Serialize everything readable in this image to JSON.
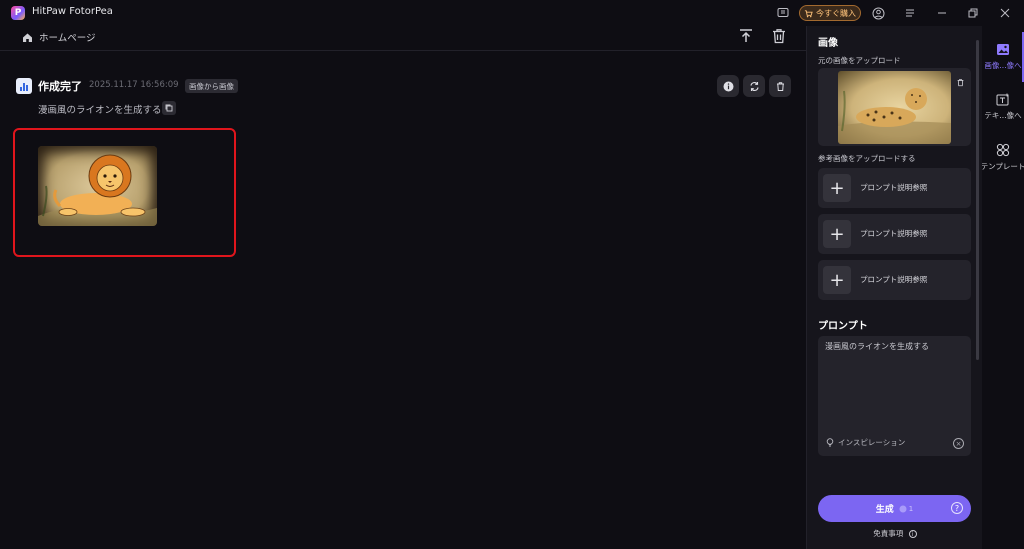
{
  "app": {
    "title": "HitPaw FotorPea",
    "logo_letter": "P"
  },
  "titlebar": {
    "buy_label": "今すぐ購入"
  },
  "nav": {
    "home_label": "ホームページ"
  },
  "result": {
    "title": "作成完了",
    "date": "2025.11.17  16:56:09",
    "tag": "画像から画像",
    "prompt": "漫画風のライオンを生成する"
  },
  "panel": {
    "section_title": "画像",
    "upload_original_label": "元の画像をアップロード",
    "upload_reference_label": "参考画像をアップロードする",
    "reference_items": [
      {
        "label": "プロンプト説明参照"
      },
      {
        "label": "プロンプト説明参照"
      },
      {
        "label": "プロンプト説明参照"
      }
    ],
    "prompt_title": "プロンプト",
    "prompt_text": "漫画風のライオンを生成する",
    "inspiration_label": "インスピレーション",
    "generate_label": "生成",
    "generate_cost": "1",
    "disclaimer": "免責事項"
  },
  "side_tabs": [
    {
      "label": "画像...像へ",
      "active": true
    },
    {
      "label": "テキ...像へ",
      "active": false
    },
    {
      "label": "テンプレート",
      "active": false
    }
  ],
  "colors": {
    "accent": "#7c66f2",
    "selection": "#e0151c",
    "buy": "#ffc37a"
  }
}
